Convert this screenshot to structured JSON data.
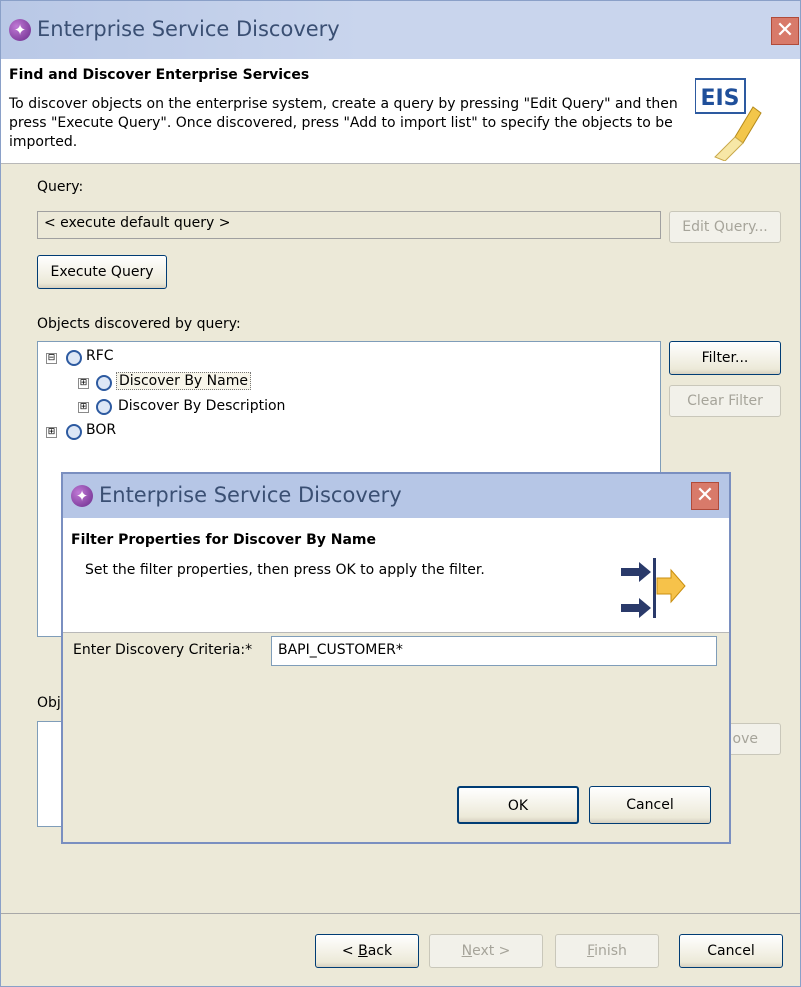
{
  "window": {
    "title": "Enterprise Service Discovery",
    "close_glyph": "✕",
    "icon": "app-logo-icon"
  },
  "header": {
    "title": "Find and Discover Enterprise Services",
    "description": "To discover objects on the enterprise system, create a query by pressing \"Edit Query\" and then press \"Execute Query\". Once discovered, press \"Add to import list\" to specify the objects to be imported.",
    "logo_text": "EIS"
  },
  "query": {
    "label": "Query:",
    "value": "< execute default query >",
    "edit_button": "Edit Query...",
    "execute_button": "Execute Query"
  },
  "objects": {
    "label": "Objects discovered by query:",
    "tree": [
      {
        "label": "RFC",
        "expander": "⊟"
      },
      {
        "label": "Discover By Name",
        "expander": "⊞"
      },
      {
        "label": "Discover By Description",
        "expander": "⊞"
      },
      {
        "label": "BOR",
        "expander": "⊞"
      }
    ],
    "filter_button": "Filter...",
    "clear_filter_button": "Clear Filter"
  },
  "import": {
    "label_partial": "Obj",
    "remove_partial": "ove"
  },
  "wizard_buttons": {
    "back_prefix": "< ",
    "back_u": "B",
    "back_rest": "ack",
    "next_u": "N",
    "next_rest": "ext >",
    "finish_u": "F",
    "finish_rest": "inish",
    "cancel": "Cancel"
  },
  "dialog": {
    "title": "Enterprise Service Discovery",
    "close_glyph": "✕",
    "header_title": "Filter Properties for Discover By Name",
    "header_desc": "Set the filter properties, then press OK to apply the filter.",
    "criteria_label": "Enter Discovery Criteria:*",
    "criteria_value": "BAPI_CUSTOMER*",
    "ok_button": "OK",
    "cancel_button": "Cancel"
  },
  "colors": {
    "accent": "#6a2a8a",
    "close_button": "#d87a6a",
    "dialog_bg": "#ece9d8"
  }
}
